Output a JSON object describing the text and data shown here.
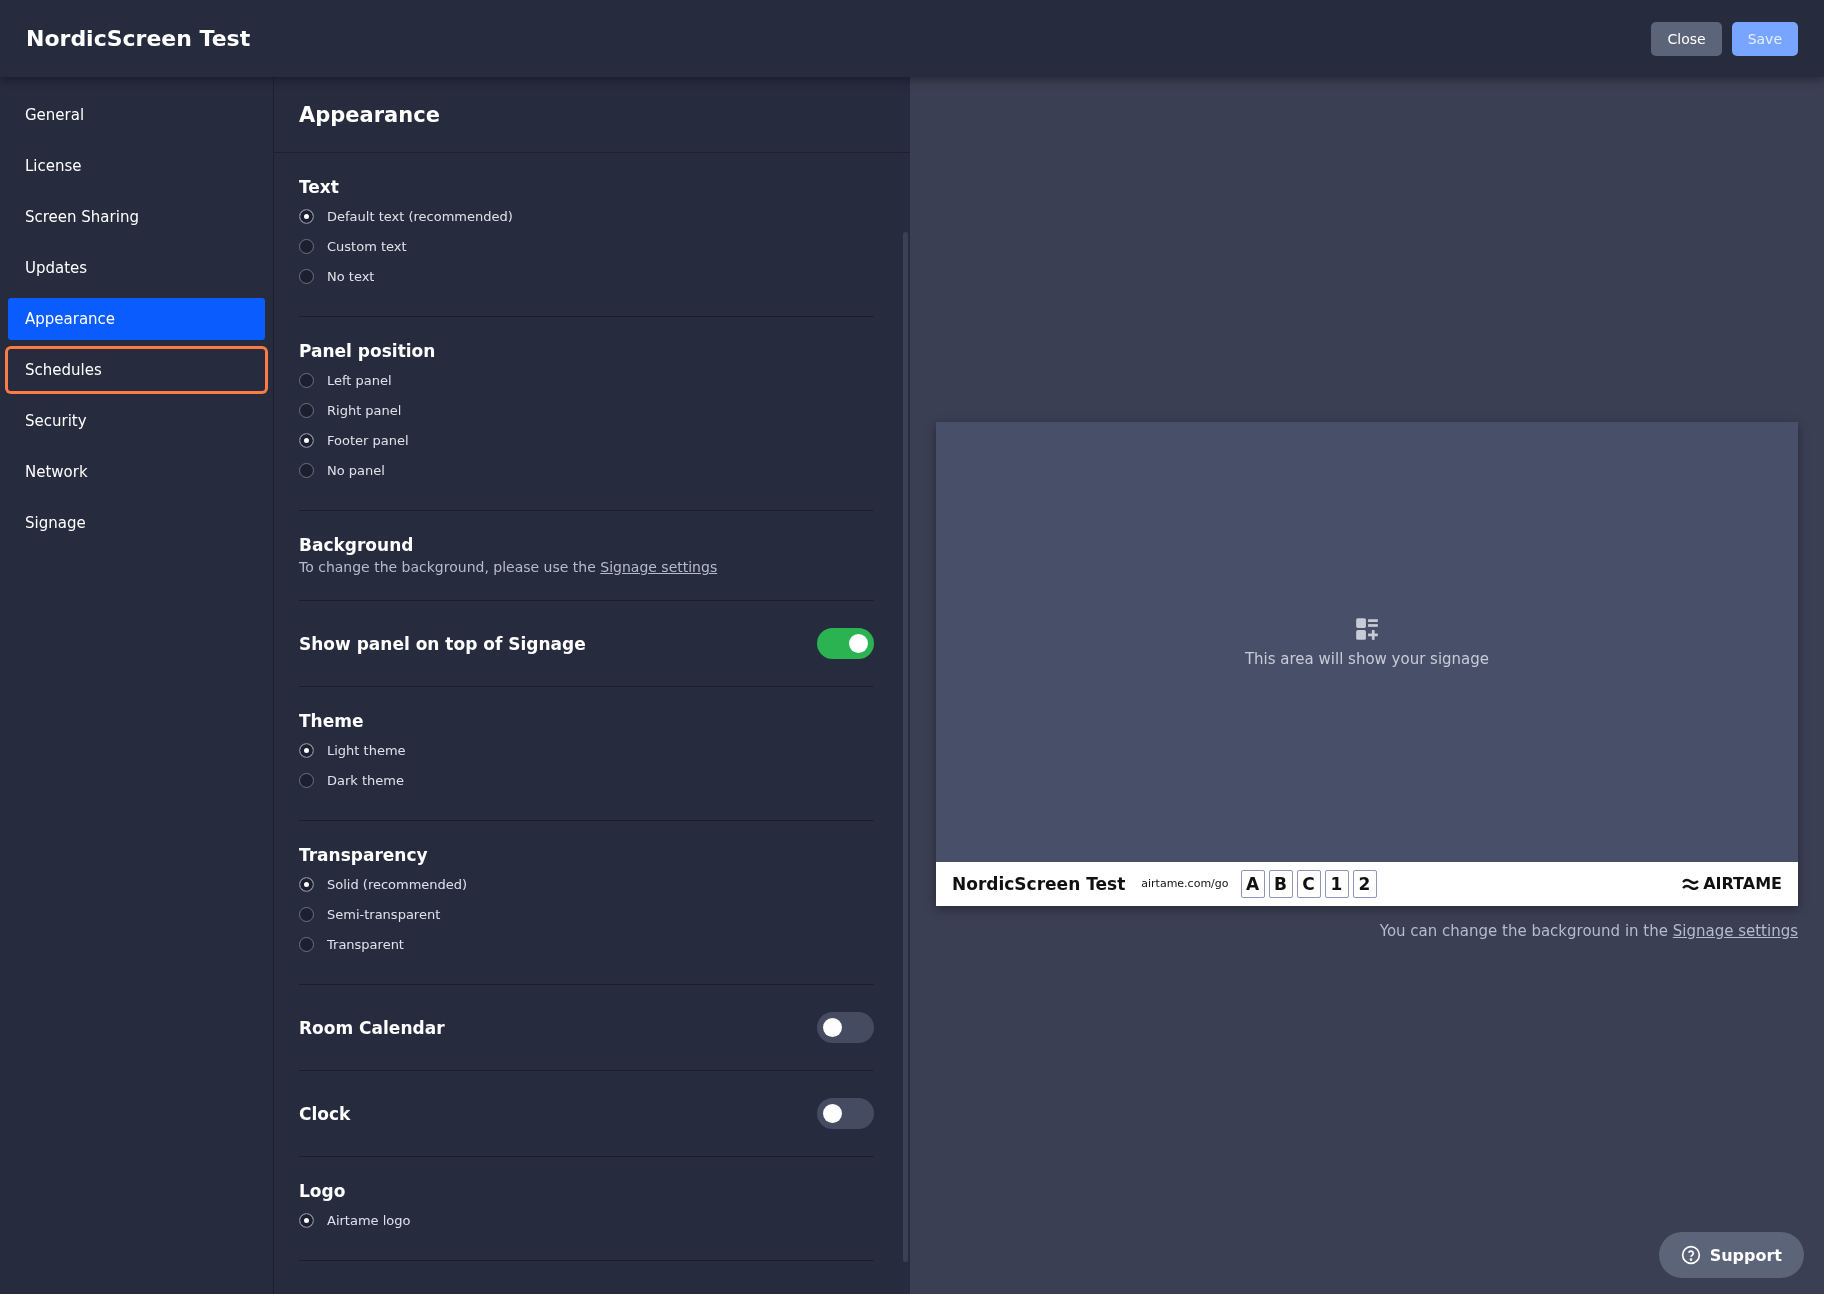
{
  "header": {
    "title": "NordicScreen Test",
    "buttons": [
      {
        "label": "Close",
        "kind": "secondary",
        "disabled": false
      },
      {
        "label": "Save",
        "kind": "primary",
        "disabled": true
      }
    ]
  },
  "sidebar": {
    "items": [
      {
        "label": "General",
        "selected": false,
        "focused": false
      },
      {
        "label": "License",
        "selected": false,
        "focused": false
      },
      {
        "label": "Screen Sharing",
        "selected": false,
        "focused": false
      },
      {
        "label": "Updates",
        "selected": false,
        "focused": false
      },
      {
        "label": "Appearance",
        "selected": true,
        "focused": false
      },
      {
        "label": "Schedules",
        "selected": false,
        "focused": true
      },
      {
        "label": "Security",
        "selected": false,
        "focused": false
      },
      {
        "label": "Network",
        "selected": false,
        "focused": false
      },
      {
        "label": "Signage",
        "selected": false,
        "focused": false
      }
    ]
  },
  "settings": {
    "title": "Appearance",
    "sections": [
      {
        "kind": "radio",
        "title": "Text",
        "options": [
          {
            "label": "Default text (recommended)",
            "selected": true
          },
          {
            "label": "Custom text",
            "selected": false
          },
          {
            "label": "No text",
            "selected": false
          }
        ]
      },
      {
        "kind": "radio",
        "title": "Panel position",
        "options": [
          {
            "label": "Left panel",
            "selected": false
          },
          {
            "label": "Right panel",
            "selected": false
          },
          {
            "label": "Footer panel",
            "selected": true
          },
          {
            "label": "No panel",
            "selected": false
          }
        ]
      },
      {
        "kind": "info",
        "title": "Background",
        "text": "To change the background, please use the",
        "link": "Signage settings"
      },
      {
        "kind": "toggle",
        "title": "Show panel on top of Signage",
        "on": true
      },
      {
        "kind": "radio",
        "title": "Theme",
        "options": [
          {
            "label": "Light theme",
            "selected": true
          },
          {
            "label": "Dark theme",
            "selected": false
          }
        ]
      },
      {
        "kind": "radio",
        "title": "Transparency",
        "options": [
          {
            "label": "Solid (recommended)",
            "selected": true
          },
          {
            "label": "Semi-transparent",
            "selected": false
          },
          {
            "label": "Transparent",
            "selected": false
          }
        ]
      },
      {
        "kind": "toggle",
        "title": "Room Calendar",
        "on": false
      },
      {
        "kind": "toggle",
        "title": "Clock",
        "on": false
      },
      {
        "kind": "radio",
        "title": "Logo",
        "options": [
          {
            "label": "Airtame logo",
            "selected": true
          }
        ]
      }
    ]
  },
  "preview": {
    "placeholder": "This area will show your signage",
    "footer": {
      "name": "NordicScreen Test",
      "url": "airtame.com/go",
      "code": [
        "A",
        "B",
        "C",
        "1",
        "2"
      ],
      "logo": "AIRTAME"
    },
    "note": "You can change the background in the",
    "note_link": "Signage settings"
  },
  "support": {
    "label": "Support"
  }
}
